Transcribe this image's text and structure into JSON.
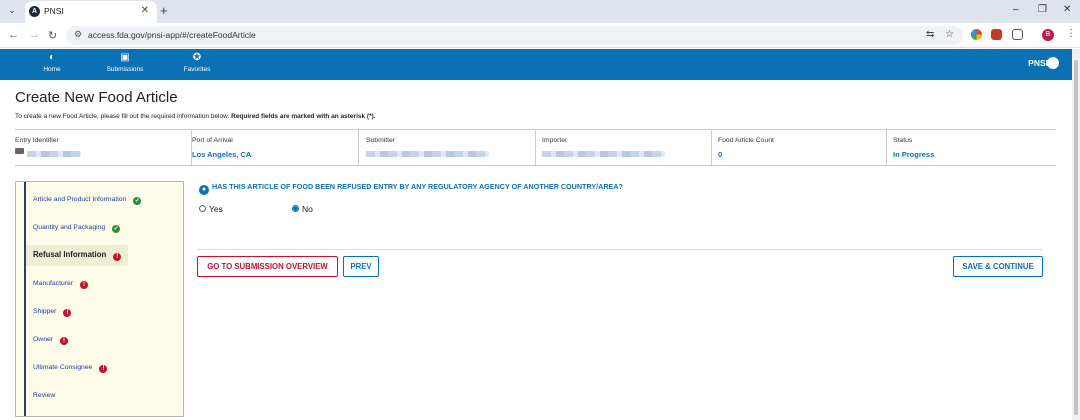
{
  "browser": {
    "tab_title": "PNSI",
    "tab_favicon_letter": "A",
    "url": "access.fda.gov/pnsi-app/#/createFoodArticle",
    "profile_letter": "B"
  },
  "header": {
    "nav": [
      {
        "label": "Home",
        "icon": "home-icon"
      },
      {
        "label": "Submissions",
        "icon": "submissions-icon"
      },
      {
        "label": "Favorites",
        "icon": "favorites-icon"
      }
    ],
    "brand": "PNSI"
  },
  "page": {
    "title": "Create New Food Article",
    "intro_text": "To create a new Food Article, please fill out the required information below.",
    "intro_bold": "Required fields are marked with an asterisk (*)."
  },
  "info": {
    "entry_identifier_label": "Entry Identifier",
    "port_label": "Port of Arrival",
    "port_value": "Los Angeles, CA",
    "submitter_label": "Submitter",
    "importer_label": "Importer",
    "count_label": "Food Article Count",
    "count_value": "0",
    "status_label": "Status",
    "status_value": "In Progress"
  },
  "steps": [
    {
      "label": "Article and Product Information",
      "state": "complete"
    },
    {
      "label": "Quantity and Packaging",
      "state": "complete"
    },
    {
      "label": "Refusal Information",
      "state": "error",
      "active": true
    },
    {
      "label": "Manufacturer",
      "state": "error"
    },
    {
      "label": "Shipper",
      "state": "error"
    },
    {
      "label": "Owner",
      "state": "error"
    },
    {
      "label": "Ultimate Consignee",
      "state": "error"
    },
    {
      "label": "Review",
      "state": "none"
    }
  ],
  "form": {
    "question": "HAS THIS ARTICLE OF FOOD BEEN REFUSED ENTRY BY ANY REGULATORY AGENCY OF ANOTHER COUNTRY/AREA?",
    "options": [
      {
        "label": "Yes",
        "selected": false
      },
      {
        "label": "No",
        "selected": true
      }
    ],
    "buttons": {
      "overview": "GO TO SUBMISSION OVERVIEW",
      "prev": "PREV",
      "save": "SAVE & CONTINUE"
    }
  },
  "colors": {
    "brand_blue": "#0b71b5",
    "error_red": "#c8102e",
    "success_green": "#2e8b3d"
  }
}
